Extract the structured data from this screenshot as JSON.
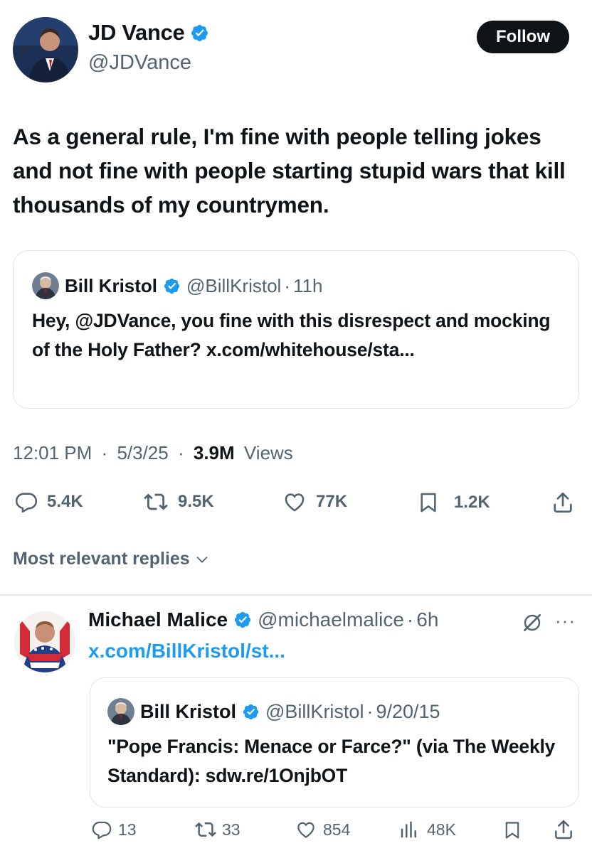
{
  "tweet": {
    "author_name": "JD Vance",
    "author_handle": "@JDVance",
    "follow_label": "Follow",
    "text": "As a general rule, I'm fine with people telling jokes and not fine with people starting stupid wars that kill thousands of my countrymen.",
    "quoted": {
      "author_name": "Bill Kristol",
      "author_handle": "@BillKristol",
      "time": "11h",
      "text": "Hey, @JDVance, you fine with this disrespect and mocking of the Holy Father? x.com/whitehouse/sta..."
    },
    "time": "12:01 PM",
    "date": "5/3/25",
    "views_count": "3.9M",
    "views_label": "Views",
    "replies": "5.4K",
    "reposts": "9.5K",
    "likes": "77K",
    "bookmarks": "1.2K"
  },
  "sort_label": "Most relevant replies",
  "reply": {
    "author_name": "Michael Malice",
    "author_handle": "@michaelmalice",
    "time": "6h",
    "link_text": "x.com/BillKristol/st...",
    "quoted": {
      "author_name": "Bill Kristol",
      "author_handle": "@BillKristol",
      "date": "9/20/15",
      "text": "\"Pope Francis: Menace or Farce?\" (via The Weekly Standard): sdw.re/1OnjbOT"
    },
    "replies": "13",
    "reposts": "33",
    "likes": "854",
    "views": "48K"
  },
  "separator": "·",
  "colors": {
    "text": "#0f1419",
    "muted": "#536471",
    "link": "#1d9bf0",
    "verified": "#1d9bf0",
    "border": "#dfe3e6"
  },
  "icons": [
    "verified-badge-icon",
    "reply-icon",
    "repost-icon",
    "like-icon",
    "bookmark-icon",
    "share-icon",
    "views-icon",
    "grok-icon",
    "more-icon",
    "chevron-down-icon"
  ]
}
